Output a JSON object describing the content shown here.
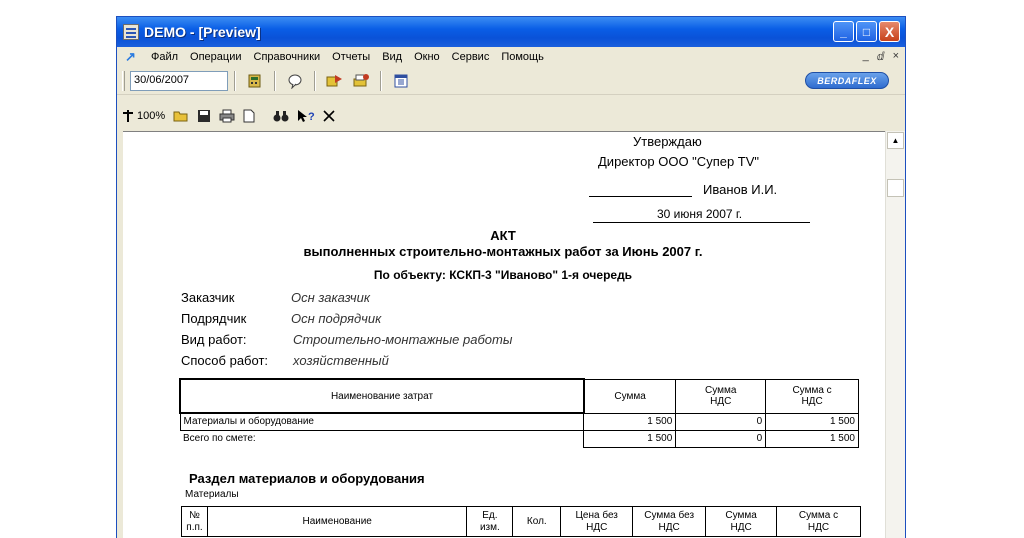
{
  "window": {
    "title": "DEMO - [Preview]",
    "controls": {
      "minimize": "_",
      "maximize": "□",
      "close": "X"
    }
  },
  "menubar": {
    "items": [
      "Файл",
      "Операции",
      "Справочники",
      "Отчеты",
      "Вид",
      "Окно",
      "Сервис",
      "Помощь"
    ],
    "mdi_controls": [
      "_",
      "ⅆ",
      "×"
    ]
  },
  "toolbar1": {
    "date_value": "30/06/2007",
    "brand_label": "BERDAFLEX"
  },
  "toolbar2": {
    "zoom": "100%"
  },
  "document": {
    "approve": "Утверждаю",
    "director": "Директор ООО \"Супер TV\"",
    "signer": "Иванов И.И.",
    "date": "30 июня 2007 г.",
    "title": "АКТ",
    "subtitle": "выполненных строительно-монтажных работ за Июнь 2007 г.",
    "object": "По объекту: КСКП-3 \"Иваново\" 1-я очередь",
    "fields": [
      {
        "label": "Заказчик",
        "value": "Осн заказчик"
      },
      {
        "label": "Подрядчик",
        "value": "Осн подрядчик"
      },
      {
        "label": "Вид работ:",
        "value": "Строительно-монтажные работы"
      },
      {
        "label": "Способ работ:",
        "value": "хозяйственный"
      }
    ],
    "summary_table": {
      "headers": [
        "Наименование затрат",
        "Сумма",
        "Сумма НДС",
        "Сумма с НДС"
      ],
      "rows": [
        {
          "name": "Материалы и оборудование",
          "sum": "1 500",
          "vat": "0",
          "total": "1 500"
        },
        {
          "name": "Всего по смете:",
          "sum": "1 500",
          "vat": "0",
          "total": "1 500"
        }
      ]
    },
    "section_title": "Раздел материалов и оборудования",
    "section_sub": "Материалы",
    "materials_table": {
      "headers": [
        "№ п.п.",
        "Наименование",
        "Ед. изм.",
        "Кол.",
        "Цена без НДС",
        "Сумма без НДС",
        "Сумма НДС",
        "Сумма с НДС"
      ]
    }
  }
}
